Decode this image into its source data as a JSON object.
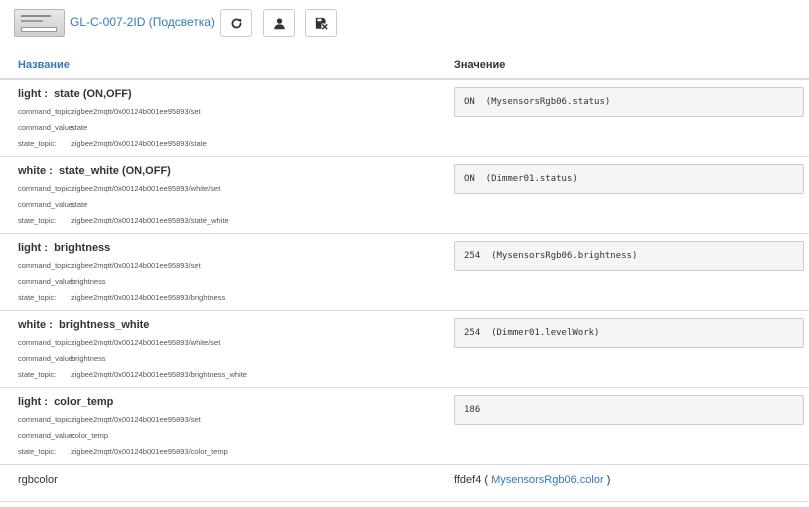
{
  "header": {
    "device_title": "GL-C-007-2ID (Подсветка)",
    "buttons": [
      {
        "icon": "refresh-icon"
      },
      {
        "icon": "user-icon"
      },
      {
        "icon": "save-remove-icon"
      }
    ]
  },
  "table": {
    "col_name": "Название",
    "col_value": "Значение"
  },
  "labels": {
    "command_topic": "command_topic:",
    "command_value": "command_value:",
    "state_topic": "state_topic:"
  },
  "rows": [
    {
      "group": "light :",
      "name": "state",
      "suffix": "(ON,OFF)",
      "command_topic": "zigbee2mqtt/0x00124b001ee95893/set",
      "command_value": "state",
      "state_topic": "zigbee2mqtt/0x00124b001ee95893/state",
      "value": "ON  (MysensorsRgb06.status)"
    },
    {
      "group": "white :",
      "name": "state_white",
      "suffix": "(ON,OFF)",
      "command_topic": "zigbee2mqtt/0x00124b001ee95893/white/set",
      "command_value": "state",
      "state_topic": "zigbee2mqtt/0x00124b001ee95893/state_white",
      "value": "ON  (Dimmer01.status)"
    },
    {
      "group": "light :",
      "name": "brightness",
      "suffix": "",
      "command_topic": "zigbee2mqtt/0x00124b001ee95893/set",
      "command_value": "brightness",
      "state_topic": "zigbee2mqtt/0x00124b001ee95893/brightness",
      "value": "254  (MysensorsRgb06.brightness)"
    },
    {
      "group": "white :",
      "name": "brightness_white",
      "suffix": "",
      "command_topic": "zigbee2mqtt/0x00124b001ee95893/white/set",
      "command_value": "brightness",
      "state_topic": "zigbee2mqtt/0x00124b001ee95893/brightness_white",
      "value": "254  (Dimmer01.levelWork)"
    },
    {
      "group": "light :",
      "name": "color_temp",
      "suffix": "",
      "command_topic": "zigbee2mqtt/0x00124b001ee95893/set",
      "command_value": "color_temp",
      "state_topic": "zigbee2mqtt/0x00124b001ee95893/color_temp",
      "value": "186"
    }
  ],
  "rgbcolor": {
    "name": "rgbcolor",
    "value": "ffdef4",
    "open_paren": "(",
    "link": "MysensorsRgb06.color",
    "close_paren": ")"
  }
}
